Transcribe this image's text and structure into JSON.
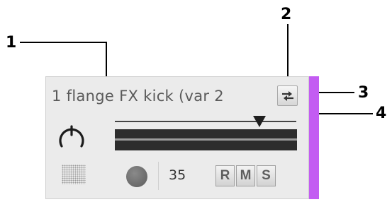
{
  "callouts": [
    "1",
    "2",
    "3",
    "4"
  ],
  "track": {
    "name": "1 flange FX kick (var 2",
    "number": "35",
    "color": "#c35cf2",
    "swap_icon": "swap-arrows-icon",
    "knob_icon": "pan-knob-icon",
    "record_icon": "record-dot-icon"
  },
  "buttons": {
    "record_arm": "R",
    "mute": "M",
    "solo": "S"
  }
}
